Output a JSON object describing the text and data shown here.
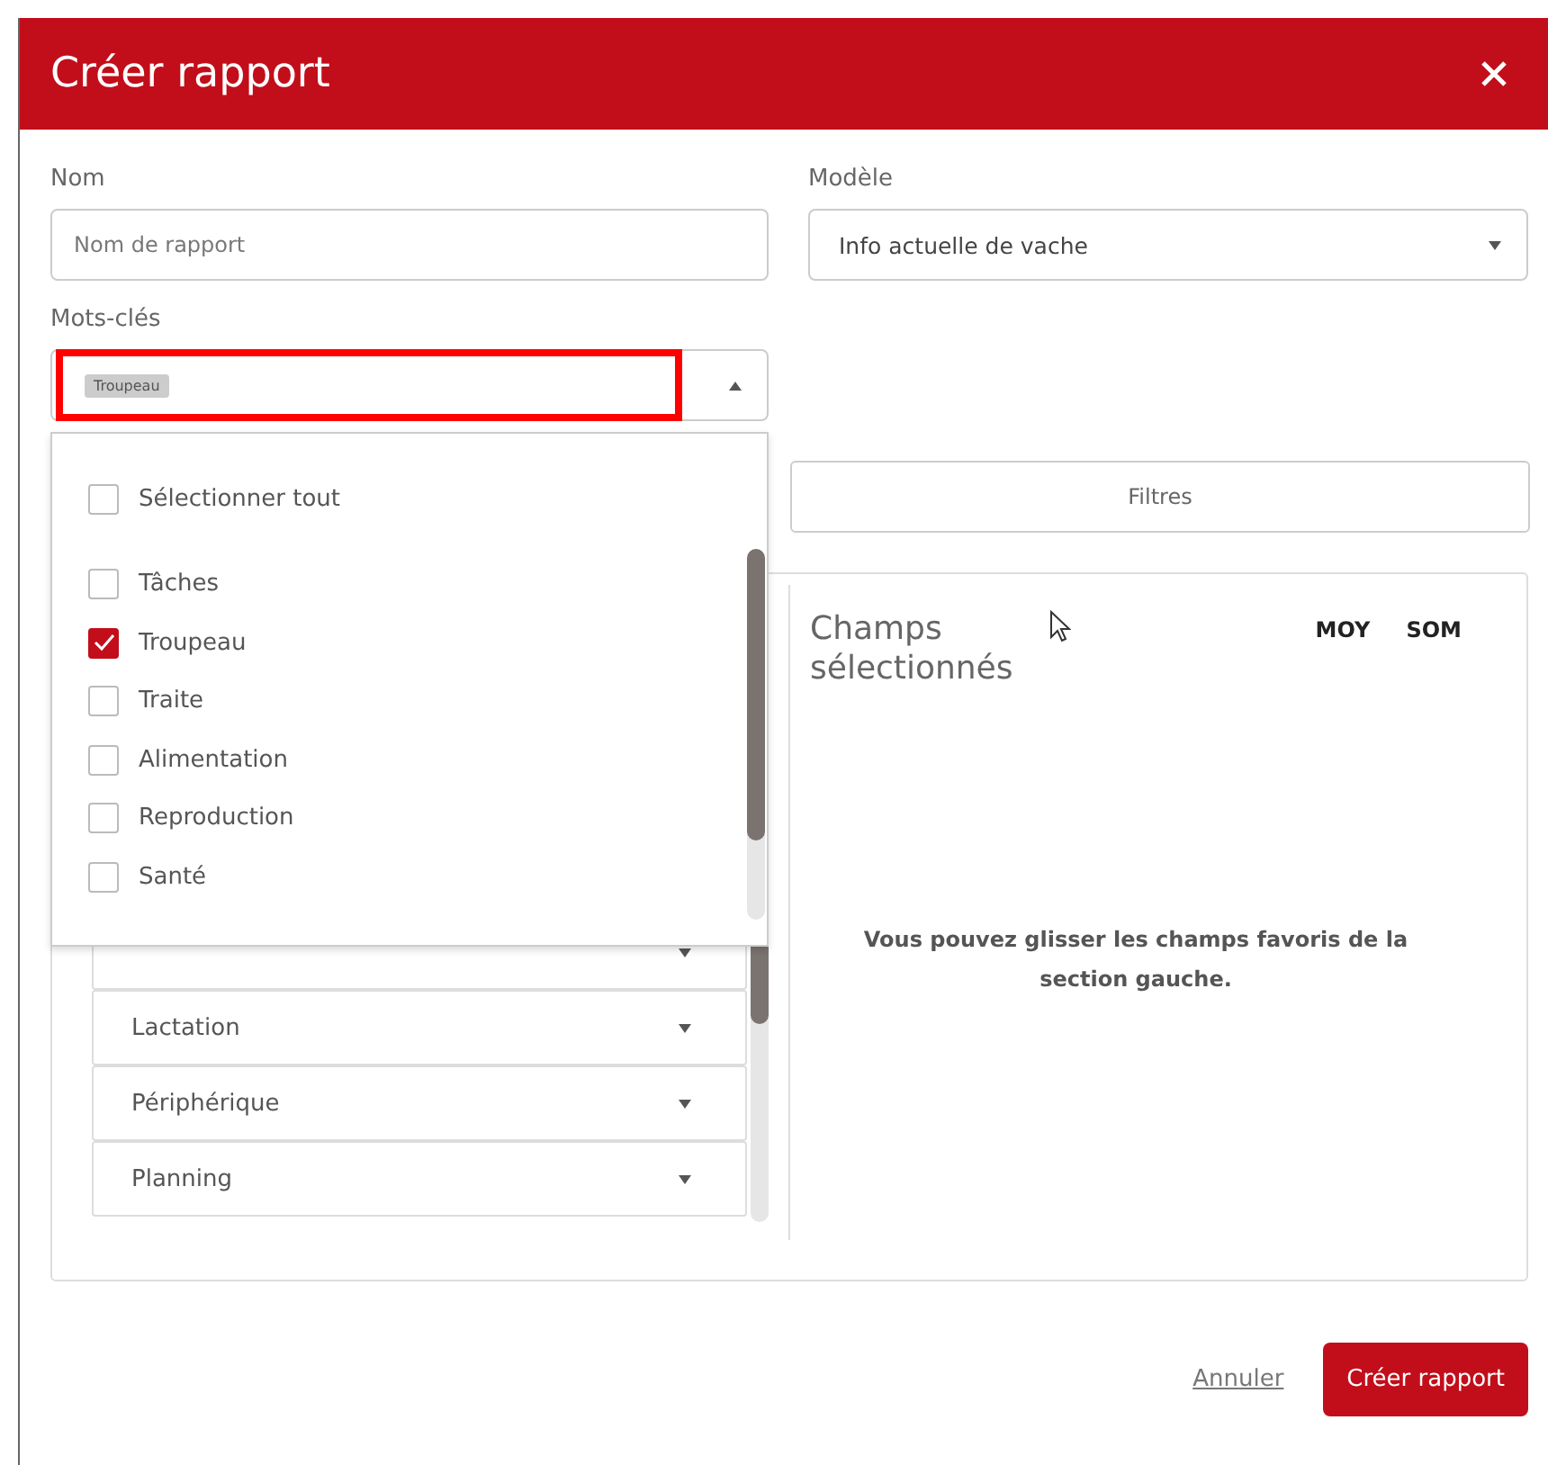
{
  "dialog": {
    "title": "Créer rapport"
  },
  "name_field": {
    "label": "Nom",
    "placeholder": "Nom de rapport"
  },
  "model_field": {
    "label": "Modèle",
    "value": "Info actuelle de vache"
  },
  "keywords_field": {
    "label": "Mots-clés",
    "tags": [
      "Troupeau"
    ],
    "expanded": true
  },
  "keywords_dropdown": {
    "select_all": {
      "label": "Sélectionner tout",
      "checked": false
    },
    "options": [
      {
        "label": "Tâches",
        "checked": false
      },
      {
        "label": "Troupeau",
        "checked": true
      },
      {
        "label": "Traite",
        "checked": false
      },
      {
        "label": "Alimentation",
        "checked": false
      },
      {
        "label": "Reproduction",
        "checked": false
      },
      {
        "label": "Santé",
        "checked": false
      }
    ]
  },
  "tabs": [
    "Filtres"
  ],
  "field_sections": [
    "Lactation",
    "Périphérique",
    "Planning"
  ],
  "selected_fields": {
    "title": "Champs sélectionnés",
    "columns": [
      "MOY",
      "SOM"
    ],
    "empty_message": "Vous pouvez glisser les champs favoris de la section gauche."
  },
  "footer": {
    "cancel": "Annuler",
    "submit": "Créer rapport"
  }
}
